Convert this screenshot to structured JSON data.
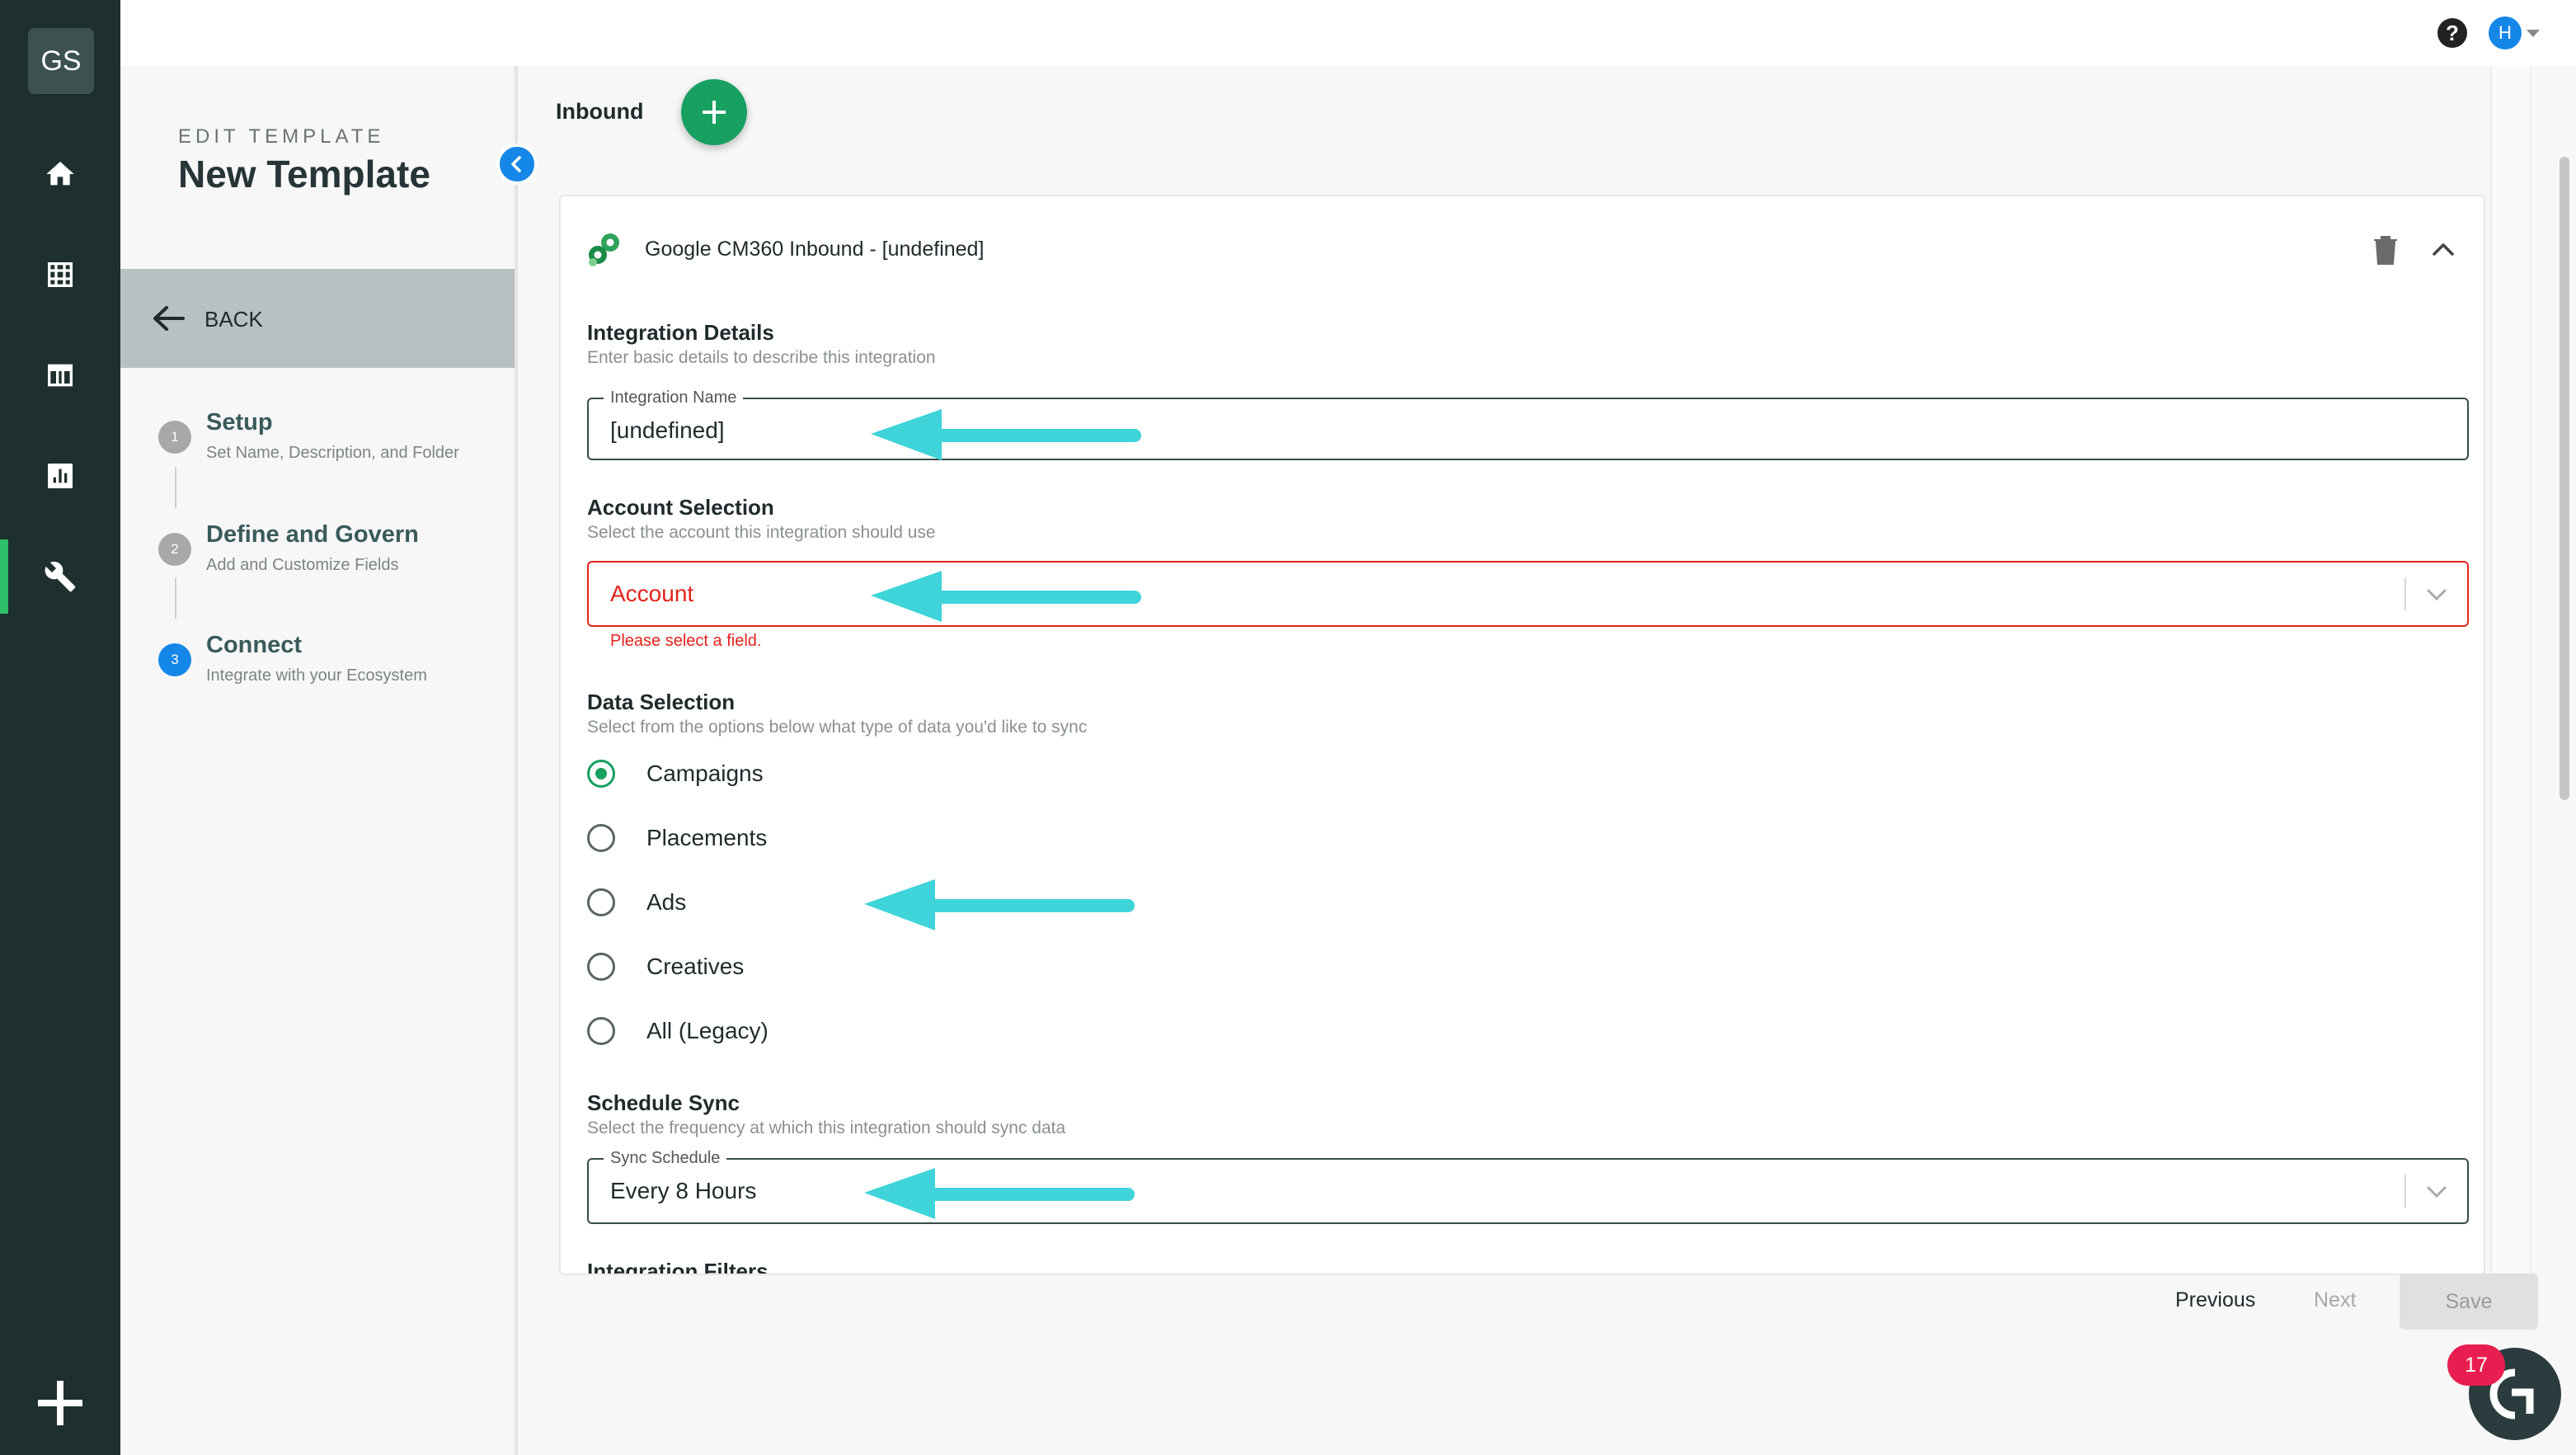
{
  "rail": {
    "logo": "GS",
    "items": [
      {
        "name": "home-icon"
      },
      {
        "name": "grid-icon"
      },
      {
        "name": "table-icon"
      },
      {
        "name": "chart-icon"
      },
      {
        "name": "wrench-icon",
        "active": true
      }
    ]
  },
  "topbar": {
    "help": "?",
    "avatar_initial": "H"
  },
  "sidebar": {
    "subtitle": "EDIT TEMPLATE",
    "title": "New Template",
    "back_label": "BACK",
    "steps": [
      {
        "number": "1",
        "title": "Setup",
        "description": "Set Name, Description, and Folder"
      },
      {
        "number": "2",
        "title": "Define and Govern",
        "description": "Add and Customize Fields"
      },
      {
        "number": "3",
        "title": "Connect",
        "description": "Integrate with your Ecosystem",
        "current": true
      }
    ]
  },
  "main": {
    "title": "Inbound",
    "card": {
      "title": "Google CM360 Inbound - [undefined]",
      "integration_details": {
        "title": "Integration Details",
        "subtitle": "Enter basic details to describe this integration",
        "field_label": "Integration Name",
        "field_value": "[undefined]"
      },
      "account_selection": {
        "title": "Account Selection",
        "subtitle": "Select the account this integration should use",
        "placeholder": "Account",
        "error": "Please select a field."
      },
      "data_selection": {
        "title": "Data Selection",
        "subtitle": "Select from the options below what type of data you'd like to sync",
        "options": [
          "Campaigns",
          "Placements",
          "Ads",
          "Creatives",
          "All (Legacy)"
        ],
        "selected": "Campaigns"
      },
      "schedule_sync": {
        "title": "Schedule Sync",
        "subtitle": "Select the frequency at which this integration should sync data",
        "field_label": "Sync Schedule",
        "field_value": "Every 8 Hours"
      },
      "integration_filters": {
        "title": "Integration Filters"
      }
    }
  },
  "footer": {
    "previous": "Previous",
    "next": "Next",
    "save": "Save"
  },
  "chat": {
    "badge": "17"
  },
  "colors": {
    "rail_bg": "#1e2f2f",
    "accent_green": "#17a060",
    "accent_blue": "#1587e8",
    "error_red": "#e2231a",
    "annotation_arrow": "#3fd4d9"
  }
}
